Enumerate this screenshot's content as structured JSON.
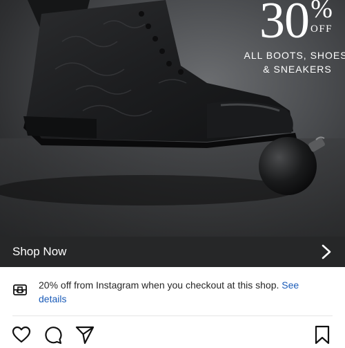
{
  "ad": {
    "promo_number": "30",
    "promo_percent": "%",
    "promo_off": "OFF",
    "promo_line1": "ALL BOOTS, SHOES,",
    "promo_line2": "& SNEAKERS"
  },
  "cta": {
    "label": "Shop Now",
    "icon": "chevron-right-icon"
  },
  "offer": {
    "icon": "gift-card-icon",
    "text": "20% off from Instagram when you checkout at this shop. ",
    "link": "See details"
  },
  "actions": {
    "like_icon": "heart-icon",
    "comment_icon": "comment-icon",
    "share_icon": "send-icon",
    "save_icon": "bookmark-icon"
  },
  "colors": {
    "cta_bar": "#262728",
    "link": "#1a5bb8"
  }
}
